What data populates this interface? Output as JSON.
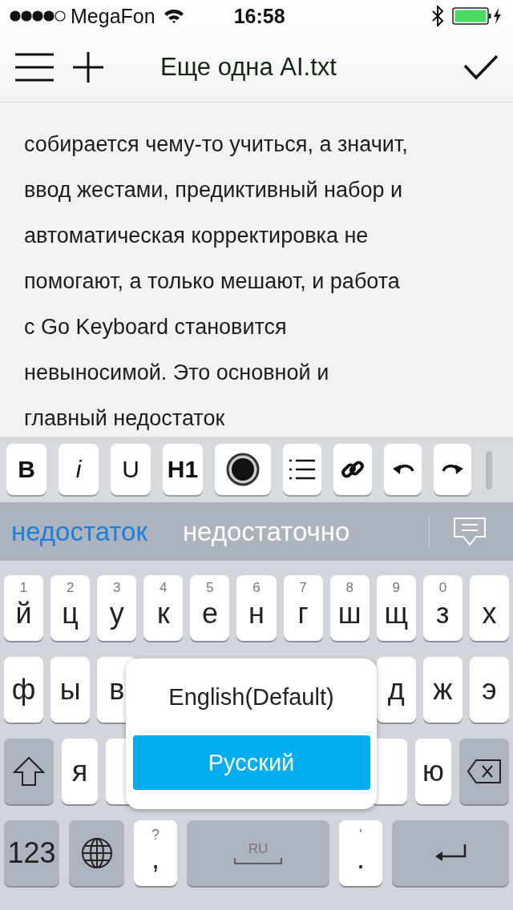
{
  "status_bar": {
    "carrier": "MegaFon",
    "time": "16:58"
  },
  "nav_bar": {
    "title": "Еще одна AI.txt"
  },
  "document": {
    "lines": [
      "собирается чему-то учиться, а значит,",
      "ввод жестами, предиктивный набор и",
      "автоматическая корректировка не",
      "помогают, а только мешают, и работа",
      "с Go Keyboard становится",
      "невыносимой. Это основной и",
      "главный недостаток"
    ]
  },
  "format_toolbar": {
    "text_buttons": [
      {
        "label": "B",
        "kind": "bold"
      },
      {
        "label": "i",
        "kind": "italic"
      },
      {
        "label": "U",
        "kind": "plain"
      },
      {
        "label": "H1",
        "kind": "bold"
      }
    ]
  },
  "suggestions": [
    {
      "text": "недостаток",
      "selected": true
    },
    {
      "text": "недостаточно",
      "selected": false
    }
  ],
  "keyboard": {
    "row_1": [
      {
        "letter": "й",
        "digit": "1"
      },
      {
        "letter": "ц",
        "digit": "2"
      },
      {
        "letter": "у",
        "digit": "3"
      },
      {
        "letter": "к",
        "digit": "4"
      },
      {
        "letter": "е",
        "digit": "5"
      },
      {
        "letter": "н",
        "digit": "6"
      },
      {
        "letter": "г",
        "digit": "7"
      },
      {
        "letter": "ш",
        "digit": "8"
      },
      {
        "letter": "щ",
        "digit": "9"
      },
      {
        "letter": "з",
        "digit": "0"
      },
      {
        "letter": "х"
      }
    ],
    "row_2_left": [
      "ф",
      "ы",
      "в"
    ],
    "row_2_right": [
      "д",
      "ж",
      "э"
    ],
    "row_3_left": [
      "я"
    ],
    "row_3_right": [
      "ю"
    ],
    "bottom_row": {
      "numbers_key": "123",
      "comma_key": {
        "letter": ",",
        "hint": "?"
      },
      "space_key": "RU",
      "period_key": {
        "letter": ".",
        "hint": "'"
      }
    }
  },
  "language_popup": {
    "options": [
      {
        "label": "English(Default)",
        "selected": false
      },
      {
        "label": "Русский",
        "selected": true
      }
    ]
  }
}
